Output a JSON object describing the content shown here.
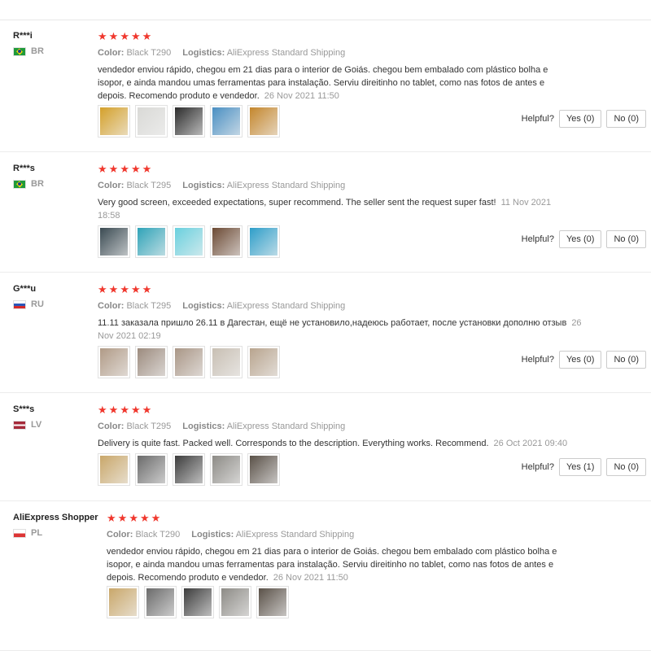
{
  "reviews": [
    {
      "user": "R***i",
      "country": "BR",
      "flag": "br",
      "rating": 5,
      "color_label": "Color:",
      "color_value": "Black T290",
      "logistics_label": "Logistics:",
      "logistics_value": "AliExpress Standard Shipping",
      "text": "vendedor enviou rápido, chegou em 21 dias para o interior de Goiás. chegou bem embalado com plástico bolha e isopor, e ainda mandou umas ferramentas para instalação. Serviu direitinho no tablet, como nas fotos de antes e depois. Recomendo produto e vendedor.",
      "date": "26 Nov 2021 11:50",
      "photos": [
        "#d4a02a",
        "#d9d9d6",
        "#2b2b2b",
        "#4a8fc2",
        "#c4862c"
      ],
      "helpful_label": "Helpful?",
      "yes_label": "Yes (0)",
      "no_label": "No (0)"
    },
    {
      "user": "R***s",
      "country": "BR",
      "flag": "br",
      "rating": 5,
      "color_label": "Color:",
      "color_value": "Black T295",
      "logistics_label": "Logistics:",
      "logistics_value": "AliExpress Standard Shipping",
      "text": "Very good screen, exceeded expectations, super recommend. The seller sent the request super fast!",
      "date": "11 Nov 2021 18:58",
      "photos": [
        "#3a4a52",
        "#2fa3b8",
        "#6ad0de",
        "#6c4a34",
        "#2e9ec9"
      ],
      "helpful_label": "Helpful?",
      "yes_label": "Yes (0)",
      "no_label": "No (0)"
    },
    {
      "user": "G***u",
      "country": "RU",
      "flag": "ru",
      "rating": 5,
      "color_label": "Color:",
      "color_value": "Black T295",
      "logistics_label": "Logistics:",
      "logistics_value": "AliExpress Standard Shipping",
      "text": "11.11 заказала пришло 26.11 в Дагестан, ещё не установило,надеюсь работает, после установки дополню отзыв",
      "date": "26 Nov 2021 02:19",
      "photos": [
        "#b09a86",
        "#9c8b7e",
        "#a99686",
        "#c8bfb3",
        "#b8a48e"
      ],
      "helpful_label": "Helpful?",
      "yes_label": "Yes (0)",
      "no_label": "No (0)"
    },
    {
      "user": "S***s",
      "country": "LV",
      "flag": "lv",
      "rating": 5,
      "color_label": "Color:",
      "color_value": "Black T295",
      "logistics_label": "Logistics:",
      "logistics_value": "AliExpress Standard Shipping",
      "text": "Delivery is quite fast. Packed well. Corresponds to the description. Everything works. Recommend.",
      "date": "26 Oct 2021 09:40",
      "photos": [
        "#c9a76a",
        "#6b6b6b",
        "#3c3c3c",
        "#8d8b86",
        "#5a5148"
      ],
      "helpful_label": "Helpful?",
      "yes_label": "Yes (1)",
      "no_label": "No (0)"
    },
    {
      "user": "AliExpress Shopper",
      "country": "PL",
      "flag": "pl",
      "rating": 5,
      "color_label": "Color:",
      "color_value": "Black T290",
      "logistics_label": "Logistics:",
      "logistics_value": "AliExpress Standard Shipping",
      "text": "vendedor enviou rápido, chegou em 21 dias para o interior de Goiás. chegou bem embalado com plástico bolha e isopor, e ainda mandou umas ferramentas para instalação. Serviu direitinho no tablet, como nas fotos de antes e depois. Recomendo produto e vendedor.",
      "date": "26 Nov 2021 11:50",
      "photos": [
        "#c9a76a",
        "#6b6b6b",
        "#3c3c3c",
        "#8d8b86",
        "#5a5148"
      ],
      "helpful_label": "",
      "yes_label": "",
      "no_label": ""
    }
  ]
}
